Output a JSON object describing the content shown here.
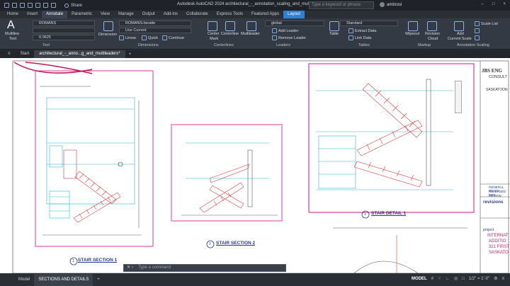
{
  "titlebar": {
    "share_label": "Share",
    "app_title": "Autodesk AutoCAD 2024   architectural_-_annotation_scaling_and_multileaders.dwg",
    "search_placeholder": "Type a keyword or phrase",
    "user_name": "ambrosl",
    "window_buttons": [
      "–",
      "□",
      "×"
    ]
  },
  "menubar": {
    "tabs": [
      "Home",
      "Insert",
      "Annotate",
      "Parametric",
      "View",
      "Manage",
      "Output",
      "Add-ins",
      "Collaborate",
      "Express Tools",
      "Featured Apps",
      "Layout"
    ],
    "active": "Annotate"
  },
  "ribbon": {
    "text_panel": {
      "big_label": "Multiline",
      "big_label2": "Text",
      "style_value": "ROMANS",
      "height_value": "0.0625",
      "panel_label": "Text"
    },
    "dimensions_panel": {
      "big_label": "Dimension",
      "style_value": "ROMANS-beside",
      "use_current": "Use Current",
      "linear": "Linear",
      "quick": "Quick",
      "continue": "Continue",
      "panel_label": "Dimensions"
    },
    "centerlines_panel": {
      "center_mark": "Center",
      "center_mark2": "Mark",
      "centerline": "Centerline",
      "panel_label": "Centerlines"
    },
    "leaders_panel": {
      "big_label": "Multileader",
      "style_value": "global",
      "add_leader": "Add Leader",
      "remove_leader": "Remove Leader",
      "panel_label": "Leaders"
    },
    "tables_panel": {
      "big_label": "Table",
      "style_value": "Standard",
      "extract_data": "Extract Data",
      "link_data": "Link Data",
      "panel_label": "Tables"
    },
    "markup_panel": {
      "wipeout": "Wipeout",
      "revision_cloud": "Revision",
      "revision_cloud2": "Cloud",
      "panel_label": "Markup"
    },
    "scaling_panel": {
      "add_current": "Add",
      "add_current2": "Current Scale",
      "scale_list": "Scale List",
      "panel_label": "Annotation Scaling"
    }
  },
  "doctabs": {
    "start": "Start",
    "active_doc": "architectural_-_anno...g_and_multileaders*"
  },
  "drawing": {
    "detail_1": {
      "number": "1",
      "title": "STAIR SECTION 1"
    },
    "detail_2": {
      "number": "2",
      "title": "STAIR SECTION 2"
    },
    "detail_3": {
      "number": "1",
      "title": "STAIR DETAIL 1"
    },
    "titleblock": {
      "firm_line1": "JBS ENG",
      "firm_line2": "CONSULT",
      "firm_line3": "SASKATOON",
      "revisions_label": "revisions",
      "rev1": "GENERAL REVISI",
      "rev2": "RELEASED FOR",
      "rev3": "REVIEW",
      "project_label": "project",
      "project1": "INTERNAT",
      "project2": "ADDITIO",
      "project3": "321 FIRST",
      "project4": "SASKATO"
    }
  },
  "command": {
    "placeholder": "Type a command"
  },
  "statusbar": {
    "tabs": [
      "Model",
      "SECTIONS AND DETAILS"
    ],
    "active": "SECTIONS AND DETAILS",
    "model_label": "MODEL",
    "scale_label": "1/2\" = 1'-0\""
  },
  "colors": {
    "sheet_border": "#e0379b",
    "stairs": "#e03c3c",
    "cyan": "#27b8d6",
    "accent": "#2f7fd6",
    "arrow": "#c2185b"
  }
}
